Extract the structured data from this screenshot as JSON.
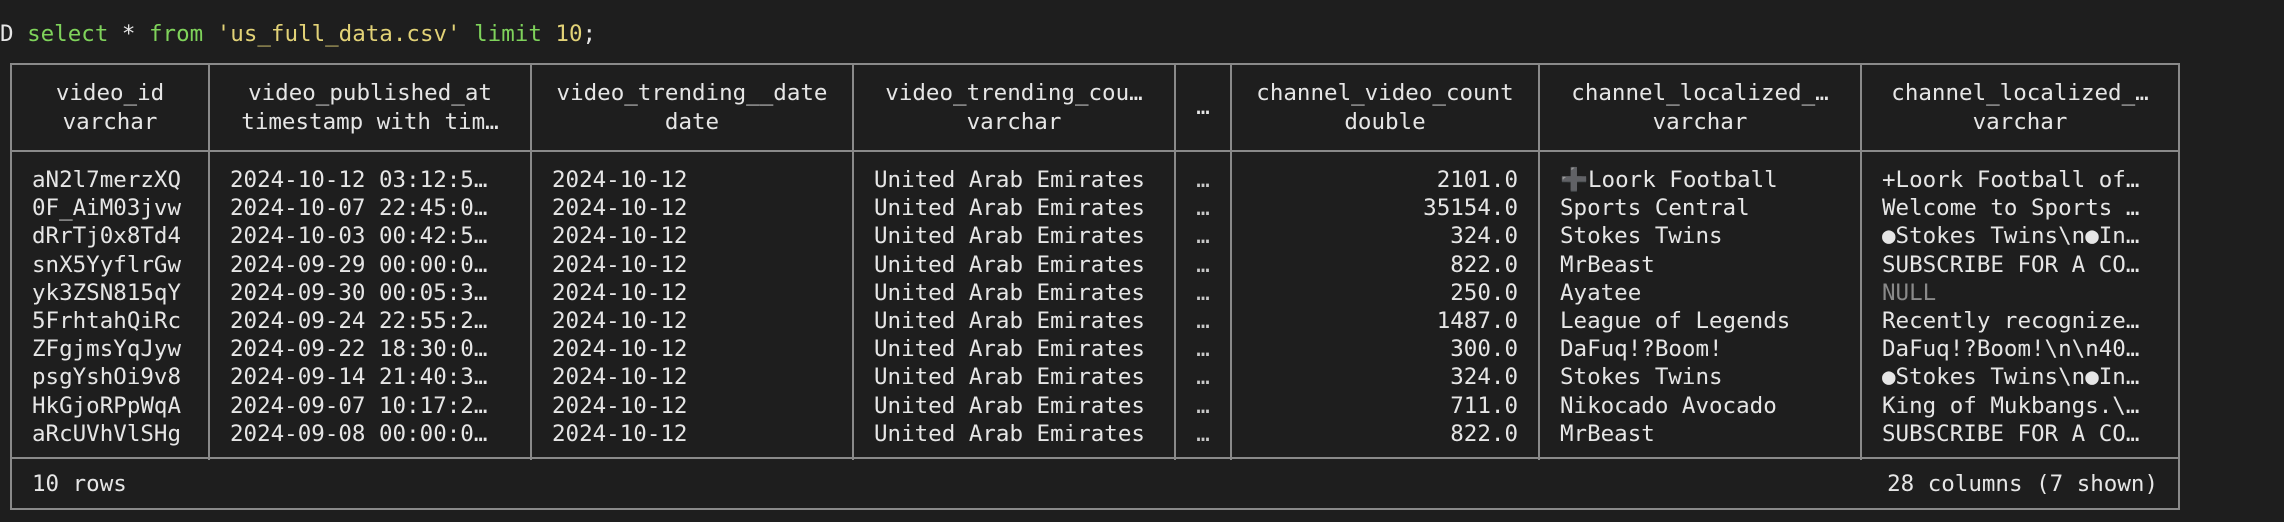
{
  "prompt": {
    "marker": "D",
    "select_kw": "select",
    "star": "*",
    "from_kw": "from",
    "source": "'us_full_data.csv'",
    "limit_kw": "limit",
    "limit_value": "10",
    "terminator": ";"
  },
  "columns": [
    {
      "name": "video_id",
      "type": "varchar"
    },
    {
      "name": "video_published_at",
      "type": "timestamp with tim…"
    },
    {
      "name": "video_trending__date",
      "type": "date"
    },
    {
      "name": "video_trending_cou…",
      "type": "varchar"
    },
    {
      "name": "…",
      "type": ""
    },
    {
      "name": "channel_video_count",
      "type": "double"
    },
    {
      "name": "channel_localized_…",
      "type": "varchar"
    },
    {
      "name": "channel_localized_…",
      "type": "varchar"
    }
  ],
  "rows": [
    {
      "c0": "aN2l7merzXQ",
      "c1": "2024-10-12 03:12:5…",
      "c2": "2024-10-12",
      "c3": "United Arab Emirates",
      "c4": "…",
      "c5": "2101.0",
      "c6": "➕Loork Football",
      "c7": "+Loork Football of…"
    },
    {
      "c0": "0F_AiM03jvw",
      "c1": "2024-10-07 22:45:0…",
      "c2": "2024-10-12",
      "c3": "United Arab Emirates",
      "c4": "…",
      "c5": "35154.0",
      "c6": "Sports Central",
      "c7": "Welcome to Sports …"
    },
    {
      "c0": "dRrTj0x8Td4",
      "c1": "2024-10-03 00:42:5…",
      "c2": "2024-10-12",
      "c3": "United Arab Emirates",
      "c4": "…",
      "c5": "324.0",
      "c6": "Stokes Twins",
      "c7": "●Stokes Twins\\n●In…"
    },
    {
      "c0": "snX5YyflrGw",
      "c1": "2024-09-29 00:00:0…",
      "c2": "2024-10-12",
      "c3": "United Arab Emirates",
      "c4": "…",
      "c5": "822.0",
      "c6": "MrBeast",
      "c7": "SUBSCRIBE FOR A CO…"
    },
    {
      "c0": "yk3ZSN815qY",
      "c1": "2024-09-30 00:05:3…",
      "c2": "2024-10-12",
      "c3": "United Arab Emirates",
      "c4": "…",
      "c5": "250.0",
      "c6": "Ayatee",
      "c7": "NULL"
    },
    {
      "c0": "5FrhtahQiRc",
      "c1": "2024-09-24 22:55:2…",
      "c2": "2024-10-12",
      "c3": "United Arab Emirates",
      "c4": "…",
      "c5": "1487.0",
      "c6": "League of Legends",
      "c7": "Recently recognize…"
    },
    {
      "c0": "ZFgjmsYqJyw",
      "c1": "2024-09-22 18:30:0…",
      "c2": "2024-10-12",
      "c3": "United Arab Emirates",
      "c4": "…",
      "c5": "300.0",
      "c6": "DaFuq!?Boom!",
      "c7": "DaFuq!?Boom!\\n\\n40…"
    },
    {
      "c0": "psgYshOi9v8",
      "c1": "2024-09-14 21:40:3…",
      "c2": "2024-10-12",
      "c3": "United Arab Emirates",
      "c4": "…",
      "c5": "324.0",
      "c6": "Stokes Twins",
      "c7": "●Stokes Twins\\n●In…"
    },
    {
      "c0": "HkGjoRPpWqA",
      "c1": "2024-09-07 10:17:2…",
      "c2": "2024-10-12",
      "c3": "United Arab Emirates",
      "c4": "…",
      "c5": "711.0",
      "c6": "Nikocado Avocado",
      "c7": "King of Mukbangs.\\…"
    },
    {
      "c0": "aRcUVhVlSHg",
      "c1": "2024-09-08 00:00:0…",
      "c2": "2024-10-12",
      "c3": "United Arab Emirates",
      "c4": "…",
      "c5": "822.0",
      "c6": "MrBeast",
      "c7": "SUBSCRIBE FOR A CO…"
    }
  ],
  "footer": {
    "row_count": "10 rows",
    "column_summary": "28 columns (7 shown)"
  },
  "colors": {
    "background": "#1e1e1e",
    "keyword": "#7fd35b",
    "string_literal": "#e2d277",
    "text": "#e6e6e6",
    "border": "#8a8a8a",
    "null_text": "#8a8a8a"
  }
}
